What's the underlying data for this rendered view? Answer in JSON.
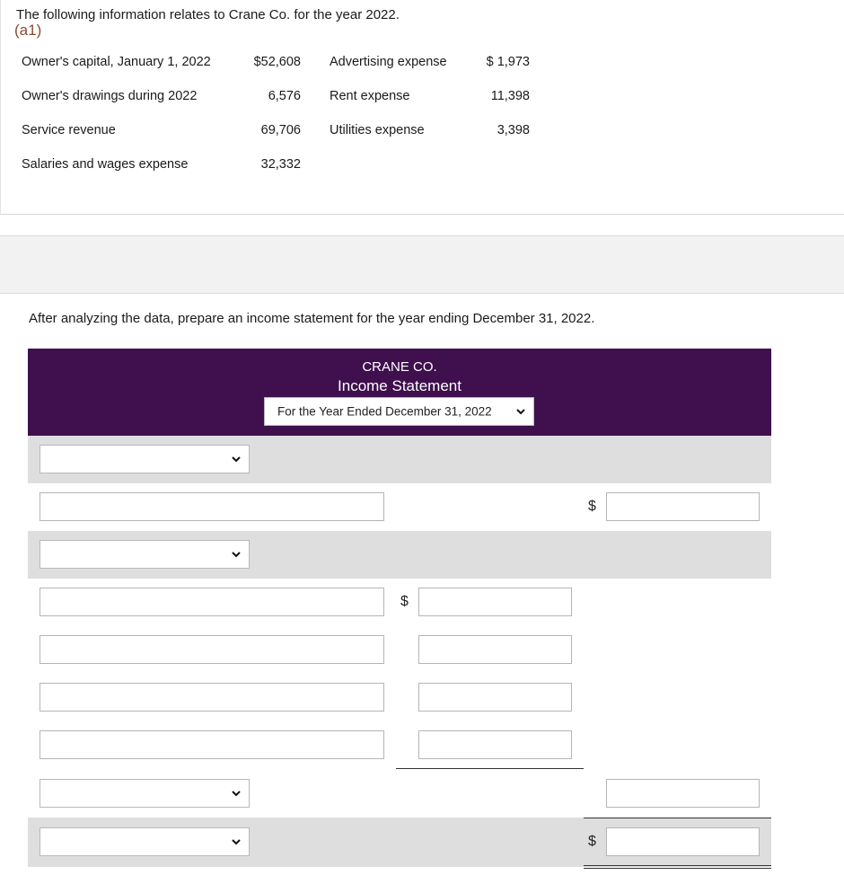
{
  "intro": "The following information relates to Crane Co. for the year 2022.",
  "accounts_left": [
    {
      "label": "Owner's capital, January 1, 2022",
      "amount": "$52,608"
    },
    {
      "label": "Owner's drawings during 2022",
      "amount": "6,576"
    },
    {
      "label": "Service revenue",
      "amount": "69,706"
    },
    {
      "label": "Salaries and wages expense",
      "amount": "32,332"
    }
  ],
  "accounts_right": [
    {
      "label": "Advertising expense",
      "amount": "$ 1,973"
    },
    {
      "label": "Rent expense",
      "amount": "11,398"
    },
    {
      "label": "Utilities expense",
      "amount": "3,398"
    }
  ],
  "part_label": "(a1)",
  "instruction": "After analyzing the data, prepare an income statement for the year ending December 31, 2022.",
  "statement": {
    "company": "CRANE CO.",
    "title": "Income Statement",
    "period_selected": "For the Year Ended December 31, 2022",
    "dollar_sign": "$"
  },
  "colors": {
    "header_bg": "#3f0f4e",
    "row_grey": "#dedede",
    "part_label": "#8a4b2f"
  }
}
